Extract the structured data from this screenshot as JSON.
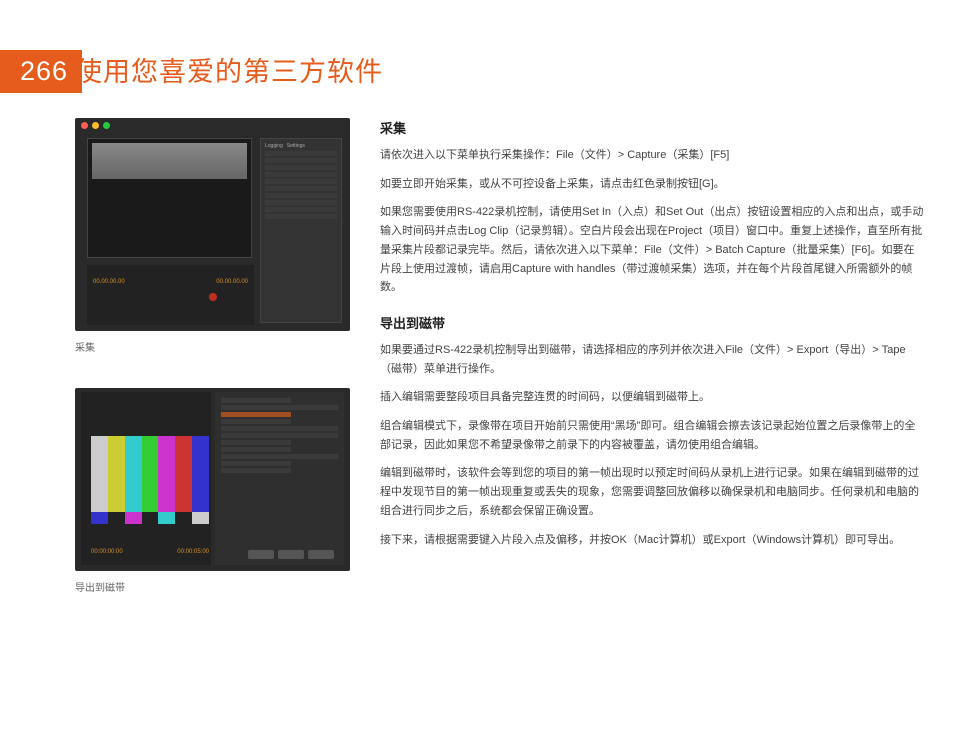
{
  "page_number": "266",
  "title": "使用您喜爱的第三方软件",
  "captions": {
    "capture": "采集",
    "export": "导出到磁带"
  },
  "screenshots": {
    "capture": {
      "side_tabs": {
        "logging": "Logging",
        "settings": "Settings"
      },
      "tc_left": "00.00.00.00",
      "tc_right": "00.00.00.00"
    },
    "export": {
      "tc_left": "00:00:00:00",
      "tc_right": "00:00:05:00"
    }
  },
  "sections": {
    "capture": {
      "heading": "采集",
      "p1": "请依次进入以下菜单执行采集操作：File（文件）> Capture（采集）[F5]",
      "p2": "如要立即开始采集，或从不可控设备上采集，请点击红色录制按钮[G]。",
      "p3": "如果您需要使用RS-422录机控制，请使用Set In（入点）和Set Out（出点）按钮设置相应的入点和出点，或手动输入时间码并点击Log Clip（记录剪辑）。空白片段会出现在Project（项目）窗口中。重复上述操作，直至所有批量采集片段都记录完毕。然后，请依次进入以下菜单：File（文件）> Batch Capture（批量采集）[F6]。如要在片段上使用过渡帧，请启用Capture with handles（带过渡帧采集）选项，并在每个片段首尾键入所需额外的帧数。"
    },
    "export": {
      "heading": "导出到磁带",
      "p1": "如果要通过RS-422录机控制导出到磁带，请选择相应的序列并依次进入File（文件）> Export（导出）> Tape（磁带）菜单进行操作。",
      "p2": "插入编辑需要整段项目具备完整连贯的时间码，以便编辑到磁带上。",
      "p3": "组合编辑模式下，录像带在项目开始前只需使用“黑场”即可。组合编辑会擦去该记录起始位置之后录像带上的全部记录，因此如果您不希望录像带之前录下的内容被覆盖，请勿使用组合编辑。",
      "p4": "编辑到磁带时，该软件会等到您的项目的第一帧出现时以预定时间码从录机上进行记录。如果在编辑到磁带的过程中发现节目的第一帧出现重复或丢失的现象，您需要调整回放偏移以确保录机和电脑同步。任何录机和电脑的组合进行同步之后，系统都会保留正确设置。",
      "p5": "接下来，请根据需要键入片段入点及偏移，并按OK（Mac计算机）或Export（Windows计算机）即可导出。"
    }
  }
}
